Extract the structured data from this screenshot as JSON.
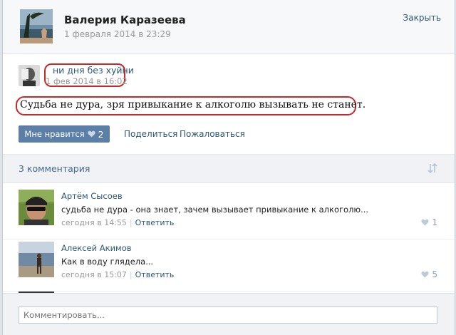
{
  "header": {
    "author_name": "Валерия Каразеева",
    "date": "1 февраля 2014 в 23:29",
    "close_label": "Закрыть"
  },
  "post": {
    "group_name": "ни дня без хуйни",
    "group_date": "1 фев 2014 в 16:02",
    "text": "Судьба не дура, зря привыкание к алкоголю вызывать не станет.",
    "like_label": "Мне нравится",
    "like_count": "2",
    "share_label": "Поделиться",
    "report_label": "Пожаловаться"
  },
  "comments_header": {
    "count_label": "3 комментария"
  },
  "comments": [
    {
      "author": "Артём Сысоев",
      "text": "судьба не дура - она знает, зачем вызывает привыкание к алкоголю...",
      "time": "сегодня в 14:55",
      "reply_label": "Ответить",
      "likes": "1"
    },
    {
      "author": "Алексей Акимов",
      "text": "Как в воду глядела...",
      "time": "сегодня в 15:07",
      "reply_label": "Ответить",
      "likes": "5"
    }
  ],
  "footer": {
    "comment_placeholder": "Комментировать..."
  },
  "colors": {
    "link": "#2b587a",
    "button": "#5b7fa6",
    "highlight_oval": "#c92828"
  }
}
